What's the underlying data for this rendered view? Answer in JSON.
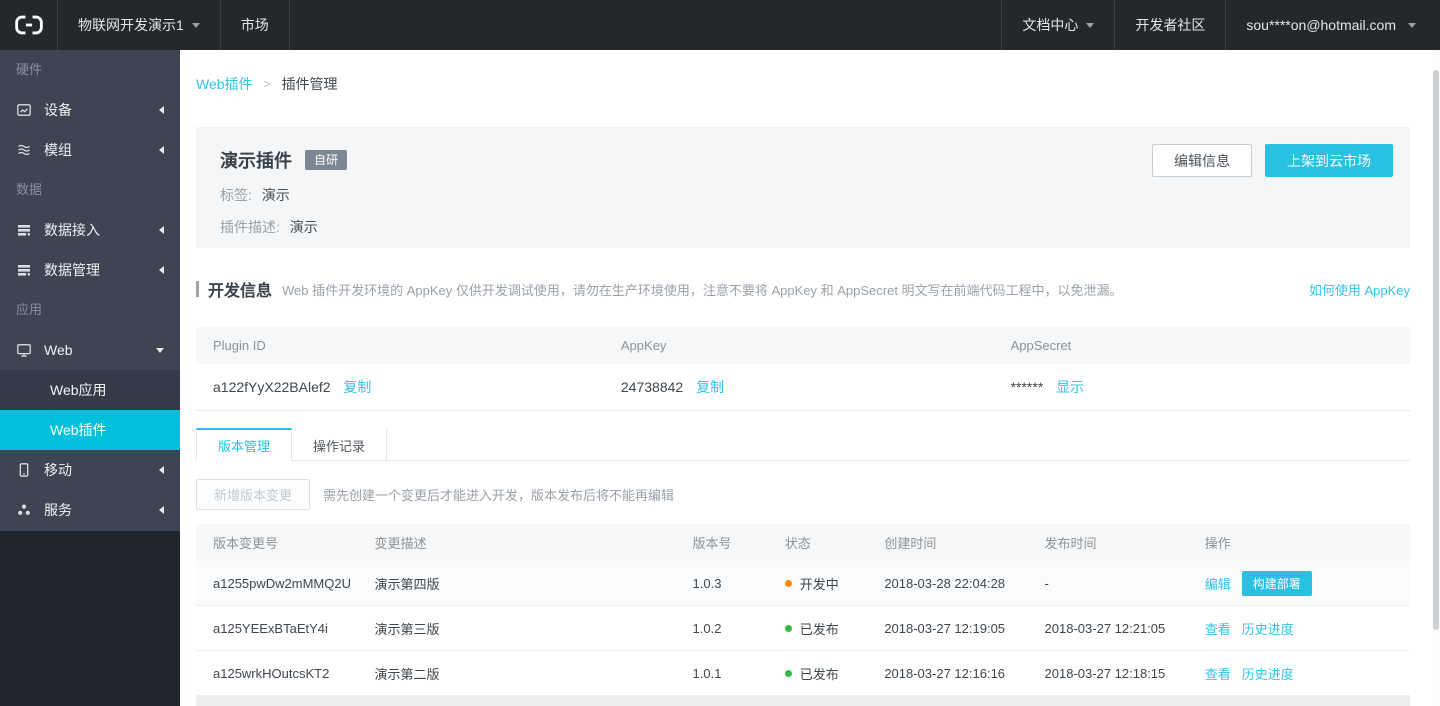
{
  "colors": {
    "accent": "#29c1e2",
    "sidebar_selected": "#00c0dc",
    "status_developing": "#ff8a00",
    "status_published": "#2fbe3f"
  },
  "navbar": {
    "project_name": "物联网开发演示1",
    "market": "市场",
    "doc_center": "文档中心",
    "dev_community": "开发者社区",
    "account": "sou****on@hotmail.com"
  },
  "sidebar": {
    "section_hardware": "硬件",
    "section_data": "数据",
    "section_app": "应用",
    "items": {
      "device": "设备",
      "module": "模组",
      "data_access": "数据接入",
      "data_manage": "数据管理",
      "web": "Web",
      "web_app": "Web应用",
      "web_plugin": "Web插件",
      "mobile": "移动",
      "service": "服务"
    }
  },
  "breadcrumb": {
    "parent": "Web插件",
    "separator": ">",
    "current": "插件管理"
  },
  "plugin_card": {
    "title": "演示插件",
    "badge": "自研",
    "tag_label": "标签:",
    "tag_value": "演示",
    "desc_label": "插件描述:",
    "desc_value": "演示",
    "edit_button": "编辑信息",
    "publish_button": "上架到云市场"
  },
  "dev_info": {
    "title": "开发信息",
    "description": "Web 插件开发环境的 AppKey 仅供开发调试使用，请勿在生产环境使用，注意不要将 AppKey 和 AppSecret 明文写在前端代码工程中，以免泄漏。",
    "help_link": "如何使用 AppKey"
  },
  "key_table": {
    "headers": [
      "Plugin ID",
      "AppKey",
      "AppSecret"
    ],
    "plugin_id": "a122fYyX22BAlef2",
    "copy_link": "复制",
    "app_key": "24738842",
    "app_secret_masked": "******",
    "show_link": "显示"
  },
  "tabs": {
    "version": "版本管理",
    "operation": "操作记录"
  },
  "version_section": {
    "add_button": "新增版本变更",
    "hint": "需先创建一个变更后才能进入开发，版本发布后将不能再编辑"
  },
  "version_table": {
    "headers": [
      "版本变更号",
      "变更描述",
      "版本号",
      "状态",
      "创建时间",
      "发布时间",
      "操作"
    ],
    "rows": [
      {
        "change_id": "a1255pwDw2mMMQ2U",
        "description": "演示第四版",
        "version": "1.0.3",
        "status": "开发中",
        "status_color": "#ff8a00",
        "created_at": "2018-03-28 22:04:28",
        "published_at": "-",
        "action_link": "编辑",
        "action_button": "构建部署"
      },
      {
        "change_id": "a125YEExBTaEtY4i",
        "description": "演示第三版",
        "version": "1.0.2",
        "status": "已发布",
        "status_color": "#2fbe3f",
        "created_at": "2018-03-27 12:19:05",
        "published_at": "2018-03-27 12:21:05",
        "action_link": "查看",
        "action_link2": "历史进度"
      },
      {
        "change_id": "a125wrkHOutcsKT2",
        "description": "演示第二版",
        "version": "1.0.1",
        "status": "已发布",
        "status_color": "#2fbe3f",
        "created_at": "2018-03-27 12:16:16",
        "published_at": "2018-03-27 12:18:15",
        "action_link": "查看",
        "action_link2": "历史进度"
      }
    ]
  }
}
